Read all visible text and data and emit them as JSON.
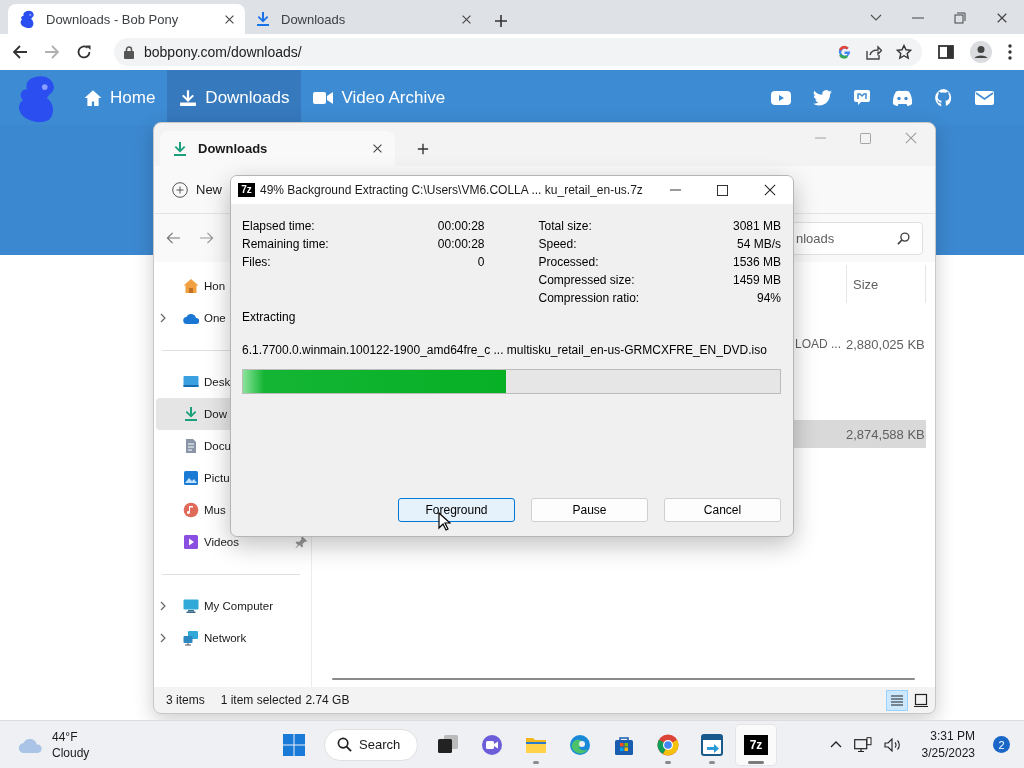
{
  "browser": {
    "tabs": [
      {
        "title": "Downloads - Bob Pony",
        "selected": true
      },
      {
        "title": "Downloads",
        "selected": false
      }
    ],
    "nav": {
      "forward_disabled": true
    },
    "address": {
      "url": "bobpony.com/downloads/"
    }
  },
  "site": {
    "nav": [
      {
        "label": "Home",
        "selected": false
      },
      {
        "label": "Downloads",
        "selected": true
      },
      {
        "label": "Video Archive",
        "selected": false
      }
    ]
  },
  "explorer": {
    "tab": {
      "title": "Downloads"
    },
    "toolbar": {
      "new_label": "New"
    },
    "search": {
      "placeholder": "nloads"
    },
    "sidebar": {
      "sections": [
        {
          "items": [
            {
              "label": "Hon",
              "kind": "plain",
              "selected": false
            },
            {
              "label": "One",
              "kind": "expandable",
              "selected": false
            }
          ]
        },
        {
          "items": [
            {
              "label": "Desk",
              "kind": "plain",
              "selected": false
            },
            {
              "label": "Dow",
              "kind": "plain",
              "selected": true
            },
            {
              "label": "Docu",
              "kind": "plain",
              "selected": false
            },
            {
              "label": "Pictu",
              "kind": "plain",
              "selected": false
            },
            {
              "label": "Mus",
              "kind": "plain",
              "selected": false
            },
            {
              "label": "Videos",
              "kind": "pinned",
              "selected": false
            }
          ]
        },
        {
          "items": [
            {
              "label": "My Computer",
              "kind": "expandable",
              "selected": false
            },
            {
              "label": "Network",
              "kind": "expandable",
              "selected": false
            }
          ]
        }
      ]
    },
    "files": {
      "columns": [
        {
          "label": "Size"
        }
      ],
      "rows": [
        {
          "name": "LOAD ...",
          "size": "2,880,025 KB",
          "selected": false
        },
        {
          "size": "2,874,588 KB",
          "selected": true
        }
      ]
    },
    "status_bar": {
      "items": "3 items",
      "selection": "1 item selected",
      "size": "2.74 GB"
    },
    "views": [
      {
        "selected": true
      },
      {
        "selected": false
      }
    ]
  },
  "dialog": {
    "icon_label": "7z",
    "title": "49% Background Extracting C:\\Users\\VM6.COLLA ... ku_retail_en-us.7z",
    "stats_left": [
      {
        "label": "Elapsed time:",
        "value": "00:00:28"
      },
      {
        "label": "Remaining time:",
        "value": "00:00:28"
      },
      {
        "label": "Files:",
        "value": "0"
      }
    ],
    "stats_right": [
      {
        "label": "Total size:",
        "value": "3081 MB"
      },
      {
        "label": "Speed:",
        "value": "54 MB/s"
      },
      {
        "label": "Processed:",
        "value": "1536 MB"
      },
      {
        "label": "Compressed size:",
        "value": "1459 MB"
      },
      {
        "label": "Compression ratio:",
        "value": "94%"
      }
    ],
    "status": "Extracting",
    "file": "6.1.7700.0.winmain.100122-1900_amd64fre_c ... multisku_retail_en-us-GRMCXFRE_EN_DVD.iso",
    "progress": {
      "level": 0.49
    },
    "buttons": [
      {
        "label": "Foreground",
        "focused": true
      },
      {
        "label": "Pause",
        "focused": false
      },
      {
        "label": "Cancel",
        "focused": false
      }
    ]
  },
  "taskbar": {
    "weather": {
      "temperature": "44°F",
      "condition": "Cloudy"
    },
    "search_label": "Search",
    "apps": [
      {
        "running": false,
        "active": false
      },
      {
        "running": false,
        "active": false
      },
      {
        "running": true,
        "active": false
      },
      {
        "running": false,
        "active": false
      },
      {
        "running": false,
        "active": false
      },
      {
        "running": true,
        "active": false
      },
      {
        "running": true,
        "active": false
      },
      {
        "running": true,
        "active": true,
        "icon_label": "7z"
      }
    ],
    "time": "3:31 PM",
    "date": "3/25/2023",
    "notifications": "2"
  }
}
